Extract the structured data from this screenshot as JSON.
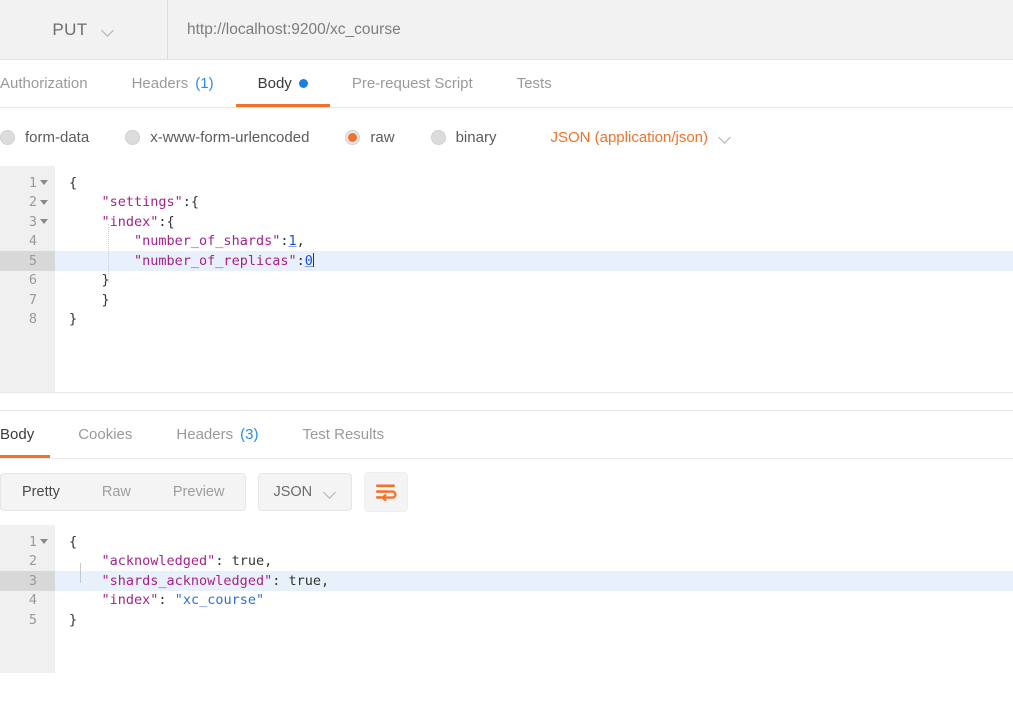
{
  "request": {
    "method": "PUT",
    "method_icon": "chevron-down-icon",
    "url": "http://localhost:9200/xc_course",
    "tabs": [
      {
        "label": "Authorization",
        "active": false,
        "count": null,
        "dot": false
      },
      {
        "label": "Headers",
        "active": false,
        "count": "(1)",
        "dot": false
      },
      {
        "label": "Body",
        "active": true,
        "count": null,
        "dot": true
      },
      {
        "label": "Pre-request Script",
        "active": false,
        "count": null,
        "dot": false
      },
      {
        "label": "Tests",
        "active": false,
        "count": null,
        "dot": false
      }
    ],
    "body_types": [
      {
        "label": "form-data",
        "selected": false
      },
      {
        "label": "x-www-form-urlencoded",
        "selected": false
      },
      {
        "label": "raw",
        "selected": true
      },
      {
        "label": "binary",
        "selected": false
      }
    ],
    "content_type": "JSON (application/json)",
    "content_type_icon": "chevron-down-icon",
    "editor": {
      "active_line": 5,
      "lines": [
        {
          "num": "1",
          "foldable": true,
          "indent": 0,
          "tokens": [
            {
              "t": "{",
              "c": "p"
            }
          ]
        },
        {
          "num": "2",
          "foldable": true,
          "indent": 1,
          "tokens": [
            {
              "t": "\"settings\"",
              "c": "k"
            },
            {
              "t": ":{",
              "c": "p"
            }
          ]
        },
        {
          "num": "3",
          "foldable": true,
          "indent": 1,
          "tokens": [
            {
              "t": "\"index\"",
              "c": "k"
            },
            {
              "t": ":{",
              "c": "p"
            }
          ]
        },
        {
          "num": "4",
          "foldable": false,
          "indent": 2,
          "tokens": [
            {
              "t": "\"number_of_shards\"",
              "c": "k"
            },
            {
              "t": ":",
              "c": "p"
            },
            {
              "t": "1",
              "c": "n"
            },
            {
              "t": ",",
              "c": "p"
            }
          ]
        },
        {
          "num": "5",
          "foldable": false,
          "indent": 2,
          "tokens": [
            {
              "t": "\"number_of_replicas\"",
              "c": "k"
            },
            {
              "t": ":",
              "c": "p"
            },
            {
              "t": "0",
              "c": "n"
            }
          ]
        },
        {
          "num": "6",
          "foldable": false,
          "indent": 1,
          "tokens": [
            {
              "t": "}",
              "c": "p"
            }
          ]
        },
        {
          "num": "7",
          "foldable": false,
          "indent": 1,
          "tokens": [
            {
              "t": "}",
              "c": "p"
            }
          ]
        },
        {
          "num": "8",
          "foldable": false,
          "indent": 0,
          "tokens": [
            {
              "t": "}",
              "c": "p"
            }
          ]
        }
      ]
    }
  },
  "response": {
    "tabs": [
      {
        "label": "Body",
        "active": true,
        "count": null
      },
      {
        "label": "Cookies",
        "active": false,
        "count": null
      },
      {
        "label": "Headers",
        "active": false,
        "count": "(3)"
      },
      {
        "label": "Test Results",
        "active": false,
        "count": null
      }
    ],
    "view_modes": [
      {
        "label": "Pretty",
        "active": true
      },
      {
        "label": "Raw",
        "active": false
      },
      {
        "label": "Preview",
        "active": false
      }
    ],
    "format": "JSON",
    "format_icon": "chevron-down-icon",
    "wrap_icon": "word-wrap-icon",
    "editor": {
      "active_line": 3,
      "lines": [
        {
          "num": "1",
          "foldable": true,
          "indent": 0,
          "tokens": [
            {
              "t": "{",
              "c": "p"
            }
          ]
        },
        {
          "num": "2",
          "foldable": false,
          "indent": 1,
          "tokens": [
            {
              "t": "\"acknowledged\"",
              "c": "k"
            },
            {
              "t": ": ",
              "c": "p"
            },
            {
              "t": "true",
              "c": "b"
            },
            {
              "t": ",",
              "c": "p"
            }
          ]
        },
        {
          "num": "3",
          "foldable": false,
          "indent": 1,
          "tokens": [
            {
              "t": "\"shards_acknowledged\"",
              "c": "k"
            },
            {
              "t": ": ",
              "c": "p"
            },
            {
              "t": "true",
              "c": "b"
            },
            {
              "t": ",",
              "c": "p"
            }
          ]
        },
        {
          "num": "4",
          "foldable": false,
          "indent": 1,
          "tokens": [
            {
              "t": "\"index\"",
              "c": "k"
            },
            {
              "t": ": ",
              "c": "p"
            },
            {
              "t": "\"xc_course\"",
              "c": "s"
            }
          ]
        },
        {
          "num": "5",
          "foldable": false,
          "indent": 0,
          "tokens": [
            {
              "t": "}",
              "c": "p"
            }
          ]
        }
      ]
    }
  },
  "colors": {
    "accent": "#f2722b",
    "link": "#2f8ce0",
    "dot": "#1c7fe0",
    "key": "#a6228a",
    "number": "#1c4fd8",
    "string": "#2b6fd8"
  }
}
